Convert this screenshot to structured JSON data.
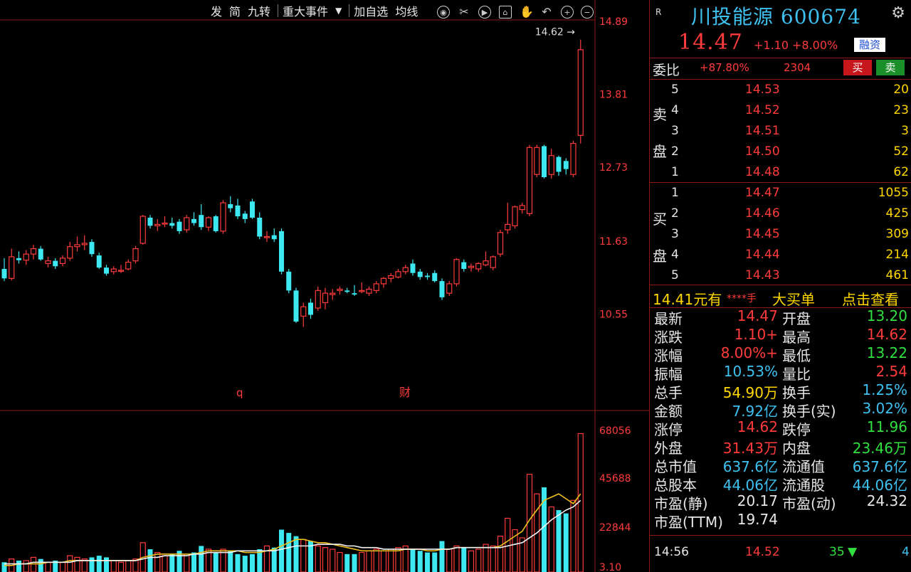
{
  "toolbar": {
    "items": [
      "发",
      "简",
      "九转",
      "重大事件",
      "加自选",
      "均线"
    ],
    "icons": [
      "eye-icon",
      "scissors-icon",
      "play-icon",
      "home-icon",
      "hand-icon",
      "undo-icon",
      "zoom-in-icon",
      "zoom-out-icon"
    ]
  },
  "price_axis": [
    "14.89",
    "13.81",
    "12.73",
    "11.63",
    "10.55"
  ],
  "max_marker": "14.62",
  "event_markers": [
    "q",
    "财"
  ],
  "vol_axis": [
    "68056",
    "45688",
    "22844",
    "3.10"
  ],
  "chart_data": {
    "type": "candlestick",
    "candles": [
      {
        "o": 11.22,
        "h": 11.38,
        "l": 11.04,
        "c": 11.08
      },
      {
        "o": 11.08,
        "h": 11.52,
        "l": 11.05,
        "c": 11.4
      },
      {
        "o": 11.38,
        "h": 11.48,
        "l": 11.3,
        "c": 11.35
      },
      {
        "o": 11.35,
        "h": 11.5,
        "l": 11.28,
        "c": 11.44
      },
      {
        "o": 11.44,
        "h": 11.58,
        "l": 11.36,
        "c": 11.52
      },
      {
        "o": 11.52,
        "h": 11.56,
        "l": 11.34,
        "c": 11.36
      },
      {
        "o": 11.3,
        "h": 11.4,
        "l": 11.24,
        "c": 11.34
      },
      {
        "o": 11.34,
        "h": 11.38,
        "l": 11.22,
        "c": 11.26
      },
      {
        "o": 11.3,
        "h": 11.42,
        "l": 11.26,
        "c": 11.38
      },
      {
        "o": 11.38,
        "h": 11.62,
        "l": 11.34,
        "c": 11.55
      },
      {
        "o": 11.55,
        "h": 11.7,
        "l": 11.48,
        "c": 11.58
      },
      {
        "o": 11.58,
        "h": 11.72,
        "l": 11.5,
        "c": 11.6
      },
      {
        "o": 11.62,
        "h": 11.66,
        "l": 11.4,
        "c": 11.44
      },
      {
        "o": 11.42,
        "h": 11.46,
        "l": 11.22,
        "c": 11.24
      },
      {
        "o": 11.24,
        "h": 11.28,
        "l": 11.12,
        "c": 11.15
      },
      {
        "o": 11.18,
        "h": 11.26,
        "l": 11.14,
        "c": 11.22
      },
      {
        "o": 11.2,
        "h": 11.28,
        "l": 11.16,
        "c": 11.2
      },
      {
        "o": 11.22,
        "h": 11.36,
        "l": 11.2,
        "c": 11.32
      },
      {
        "o": 11.34,
        "h": 11.56,
        "l": 11.3,
        "c": 11.52
      },
      {
        "o": 11.6,
        "h": 12.02,
        "l": 11.58,
        "c": 12.0
      },
      {
        "o": 11.98,
        "h": 12.02,
        "l": 11.82,
        "c": 11.86
      },
      {
        "o": 11.86,
        "h": 11.96,
        "l": 11.78,
        "c": 11.88
      },
      {
        "o": 11.9,
        "h": 12.0,
        "l": 11.84,
        "c": 11.9
      },
      {
        "o": 11.9,
        "h": 11.98,
        "l": 11.82,
        "c": 11.86
      },
      {
        "o": 11.92,
        "h": 11.96,
        "l": 11.74,
        "c": 11.78
      },
      {
        "o": 11.8,
        "h": 12.02,
        "l": 11.76,
        "c": 11.98
      },
      {
        "o": 11.96,
        "h": 12.06,
        "l": 11.86,
        "c": 11.9
      },
      {
        "o": 12.02,
        "h": 12.18,
        "l": 11.8,
        "c": 11.84
      },
      {
        "o": 11.84,
        "h": 12.0,
        "l": 11.78,
        "c": 11.98
      },
      {
        "o": 12.0,
        "h": 12.02,
        "l": 11.76,
        "c": 11.78
      },
      {
        "o": 11.78,
        "h": 12.24,
        "l": 11.74,
        "c": 12.2
      },
      {
        "o": 12.18,
        "h": 12.3,
        "l": 12.06,
        "c": 12.12
      },
      {
        "o": 12.16,
        "h": 12.26,
        "l": 11.96,
        "c": 12.0
      },
      {
        "o": 12.04,
        "h": 12.08,
        "l": 11.9,
        "c": 11.96
      },
      {
        "o": 12.22,
        "h": 12.26,
        "l": 11.96,
        "c": 11.98
      },
      {
        "o": 11.98,
        "h": 12.06,
        "l": 11.66,
        "c": 11.7
      },
      {
        "o": 11.7,
        "h": 11.78,
        "l": 11.62,
        "c": 11.7
      },
      {
        "o": 11.72,
        "h": 11.82,
        "l": 11.62,
        "c": 11.66
      },
      {
        "o": 11.78,
        "h": 11.82,
        "l": 11.14,
        "c": 11.18
      },
      {
        "o": 11.18,
        "h": 11.22,
        "l": 10.86,
        "c": 10.9
      },
      {
        "o": 10.9,
        "h": 10.94,
        "l": 10.42,
        "c": 10.44
      },
      {
        "o": 10.52,
        "h": 10.72,
        "l": 10.36,
        "c": 10.66
      },
      {
        "o": 10.72,
        "h": 10.78,
        "l": 10.48,
        "c": 10.54
      },
      {
        "o": 10.64,
        "h": 10.96,
        "l": 10.6,
        "c": 10.9
      },
      {
        "o": 10.72,
        "h": 10.94,
        "l": 10.62,
        "c": 10.86
      },
      {
        "o": 10.84,
        "h": 10.92,
        "l": 10.76,
        "c": 10.86
      },
      {
        "o": 10.9,
        "h": 10.96,
        "l": 10.84,
        "c": 10.92
      },
      {
        "o": 10.9,
        "h": 10.94,
        "l": 10.86,
        "c": 10.88
      },
      {
        "o": 10.86,
        "h": 10.98,
        "l": 10.82,
        "c": 10.84
      },
      {
        "o": 10.9,
        "h": 11.02,
        "l": 10.86,
        "c": 10.9
      },
      {
        "o": 10.86,
        "h": 10.96,
        "l": 10.82,
        "c": 10.92
      },
      {
        "o": 10.9,
        "h": 11.04,
        "l": 10.86,
        "c": 11.0
      },
      {
        "o": 11.0,
        "h": 11.1,
        "l": 10.94,
        "c": 11.08
      },
      {
        "o": 11.08,
        "h": 11.16,
        "l": 11.02,
        "c": 11.12
      },
      {
        "o": 11.1,
        "h": 11.22,
        "l": 11.08,
        "c": 11.18
      },
      {
        "o": 11.18,
        "h": 11.28,
        "l": 11.14,
        "c": 11.24
      },
      {
        "o": 11.3,
        "h": 11.36,
        "l": 11.12,
        "c": 11.16
      },
      {
        "o": 11.18,
        "h": 11.22,
        "l": 11.06,
        "c": 11.1
      },
      {
        "o": 11.12,
        "h": 11.16,
        "l": 11.06,
        "c": 11.1
      },
      {
        "o": 11.16,
        "h": 11.2,
        "l": 11.02,
        "c": 11.04
      },
      {
        "o": 11.04,
        "h": 11.08,
        "l": 10.76,
        "c": 10.8
      },
      {
        "o": 10.86,
        "h": 11.04,
        "l": 10.82,
        "c": 11.0
      },
      {
        "o": 11.0,
        "h": 11.38,
        "l": 10.96,
        "c": 11.36
      },
      {
        "o": 11.32,
        "h": 11.36,
        "l": 11.18,
        "c": 11.22
      },
      {
        "o": 11.24,
        "h": 11.3,
        "l": 11.18,
        "c": 11.26
      },
      {
        "o": 11.22,
        "h": 11.32,
        "l": 11.18,
        "c": 11.3
      },
      {
        "o": 11.28,
        "h": 11.48,
        "l": 11.26,
        "c": 11.34
      },
      {
        "o": 11.24,
        "h": 11.42,
        "l": 11.2,
        "c": 11.4
      },
      {
        "o": 11.44,
        "h": 11.8,
        "l": 11.4,
        "c": 11.76
      },
      {
        "o": 11.8,
        "h": 12.2,
        "l": 11.74,
        "c": 11.88
      },
      {
        "o": 11.86,
        "h": 12.16,
        "l": 11.82,
        "c": 12.14
      },
      {
        "o": 12.1,
        "h": 12.2,
        "l": 12.04,
        "c": 12.16
      },
      {
        "o": 12.04,
        "h": 13.06,
        "l": 12.0,
        "c": 13.02
      },
      {
        "o": 12.62,
        "h": 13.06,
        "l": 12.58,
        "c": 13.02
      },
      {
        "o": 13.04,
        "h": 13.06,
        "l": 12.56,
        "c": 12.58
      },
      {
        "o": 12.62,
        "h": 13.0,
        "l": 12.56,
        "c": 12.9
      },
      {
        "o": 12.88,
        "h": 12.9,
        "l": 12.6,
        "c": 12.66
      },
      {
        "o": 12.82,
        "h": 12.86,
        "l": 12.62,
        "c": 12.7
      },
      {
        "o": 12.62,
        "h": 13.12,
        "l": 12.58,
        "c": 13.08
      },
      {
        "o": 13.2,
        "h": 14.62,
        "l": 13.08,
        "c": 14.47
      }
    ],
    "volumes": [
      6,
      8,
      7,
      7,
      9,
      8,
      6,
      7,
      6,
      10,
      9,
      8,
      9,
      10,
      9,
      7,
      6,
      7,
      8,
      18,
      14,
      12,
      10,
      11,
      13,
      11,
      12,
      16,
      14,
      12,
      14,
      13,
      11,
      10,
      11,
      14,
      16,
      15,
      26,
      24,
      22,
      20,
      19,
      16,
      15,
      14,
      12,
      11,
      11,
      12,
      13,
      14,
      13,
      14,
      15,
      16,
      14,
      13,
      12,
      12,
      19,
      14,
      16,
      15,
      13,
      14,
      17,
      16,
      22,
      33,
      26,
      21,
      60,
      48,
      52,
      40,
      38,
      36,
      44,
      85
    ],
    "ma5": [
      4,
      4,
      5,
      5,
      5,
      5,
      6,
      6,
      6,
      7,
      7,
      7,
      7,
      7,
      7,
      7,
      7,
      7,
      7,
      9,
      10,
      11,
      11,
      11,
      11,
      11,
      11,
      12,
      13,
      13,
      13,
      13,
      13,
      12,
      12,
      12,
      13,
      14,
      16,
      18,
      20,
      20,
      19,
      18,
      18,
      17,
      16,
      15,
      14,
      13,
      13,
      13,
      13,
      13,
      13,
      14,
      14,
      14,
      13,
      13,
      14,
      14,
      15,
      15,
      15,
      15,
      15,
      15,
      16,
      19,
      22,
      25,
      32,
      38,
      44,
      46,
      48,
      45,
      42,
      48
    ],
    "ma10": [
      5,
      5,
      5,
      5,
      6,
      6,
      6,
      6,
      6,
      6,
      7,
      7,
      7,
      7,
      7,
      7,
      7,
      7,
      7,
      8,
      9,
      9,
      10,
      10,
      10,
      10,
      11,
      11,
      12,
      12,
      12,
      12,
      13,
      13,
      13,
      13,
      13,
      13,
      14,
      15,
      16,
      16,
      16,
      17,
      17,
      17,
      17,
      16,
      16,
      15,
      15,
      15,
      14,
      14,
      14,
      14,
      14,
      14,
      14,
      14,
      14,
      14,
      15,
      15,
      15,
      15,
      15,
      15,
      15,
      16,
      17,
      18,
      21,
      24,
      28,
      32,
      35,
      38,
      40,
      44
    ],
    "ymin": 10.25,
    "ymax": 14.89
  },
  "header": {
    "r_label": "R",
    "title": "川投能源 600674",
    "price": "14.47",
    "change": "+1.10",
    "pct": "+8.00%",
    "tag": "融资"
  },
  "weibi": {
    "label": "委比",
    "pct": "+87.80%",
    "diff": "2304",
    "buy": "买",
    "sell": "卖"
  },
  "sell_label": [
    "卖",
    "盘"
  ],
  "buy_label": [
    "买",
    "盘"
  ],
  "asks": [
    {
      "lv": "5",
      "price": "14.53",
      "vol": "20"
    },
    {
      "lv": "4",
      "price": "14.52",
      "vol": "23"
    },
    {
      "lv": "3",
      "price": "14.51",
      "vol": "3"
    },
    {
      "lv": "2",
      "price": "14.50",
      "vol": "52"
    },
    {
      "lv": "1",
      "price": "14.48",
      "vol": "62"
    }
  ],
  "bids": [
    {
      "lv": "1",
      "price": "14.47",
      "vol": "1055"
    },
    {
      "lv": "2",
      "price": "14.46",
      "vol": "425"
    },
    {
      "lv": "3",
      "price": "14.45",
      "vol": "309"
    },
    {
      "lv": "4",
      "price": "14.44",
      "vol": "214"
    },
    {
      "lv": "5",
      "price": "14.43",
      "vol": "461"
    }
  ],
  "big_order": {
    "price": "14.41元有",
    "qty": "****手",
    "label": "大买单",
    "link": "点击查看"
  },
  "stats": [
    {
      "l1": "最新",
      "v1": "14.47",
      "c1": "red",
      "l2": "开盘",
      "v2": "13.20",
      "c2": "grn"
    },
    {
      "l1": "涨跌",
      "v1": "+1.10",
      "c1": "red",
      "l2": "最高",
      "v2": "14.62",
      "c2": "red"
    },
    {
      "l1": "涨幅",
      "v1": "+8.00%",
      "c1": "red",
      "l2": "最低",
      "v2": "13.22",
      "c2": "grn"
    },
    {
      "l1": "振幅",
      "v1": "10.53%",
      "c1": "cyan",
      "l2": "量比",
      "v2": "2.54",
      "c2": "red"
    },
    {
      "l1": "总手",
      "v1": "54.90万",
      "c1": "ylw",
      "l2": "换手",
      "v2": "1.25%",
      "c2": "cyan"
    },
    {
      "l1": "金额",
      "v1": "7.92亿",
      "c1": "cyan",
      "l2": "换手(实)",
      "v2": "3.02%",
      "c2": "cyan"
    },
    {
      "l1": "涨停",
      "v1": "14.62",
      "c1": "red",
      "l2": "跌停",
      "v2": "11.96",
      "c2": "grn"
    },
    {
      "l1": "外盘",
      "v1": "31.43万",
      "c1": "red",
      "l2": "内盘",
      "v2": "23.46万",
      "c2": "grn"
    },
    {
      "l1": "总市值",
      "v1": "637.6亿",
      "c1": "cyan",
      "l2": "流通值",
      "v2": "637.6亿",
      "c2": "cyan"
    },
    {
      "l1": "总股本",
      "v1": "44.06亿",
      "c1": "cyan",
      "l2": "流通股",
      "v2": "44.06亿",
      "c2": "cyan"
    },
    {
      "l1": "市盈(静)",
      "v1": "20.17",
      "c1": "wht",
      "l2": "市盈(动)",
      "v2": "24.32",
      "c2": "wht"
    },
    {
      "l1": "市盈(TTM)",
      "v1": "19.74",
      "c1": "wht",
      "l2": "",
      "v2": "",
      "c2": "wht"
    }
  ],
  "tick": {
    "time": "14:56",
    "price": "14.52",
    "vol": "35",
    "n": "4"
  },
  "colors": {
    "up": "#ff3b3b",
    "down": "#3de8f0",
    "cyan": "#3ec1f0",
    "grid": "#8b1a1a"
  }
}
